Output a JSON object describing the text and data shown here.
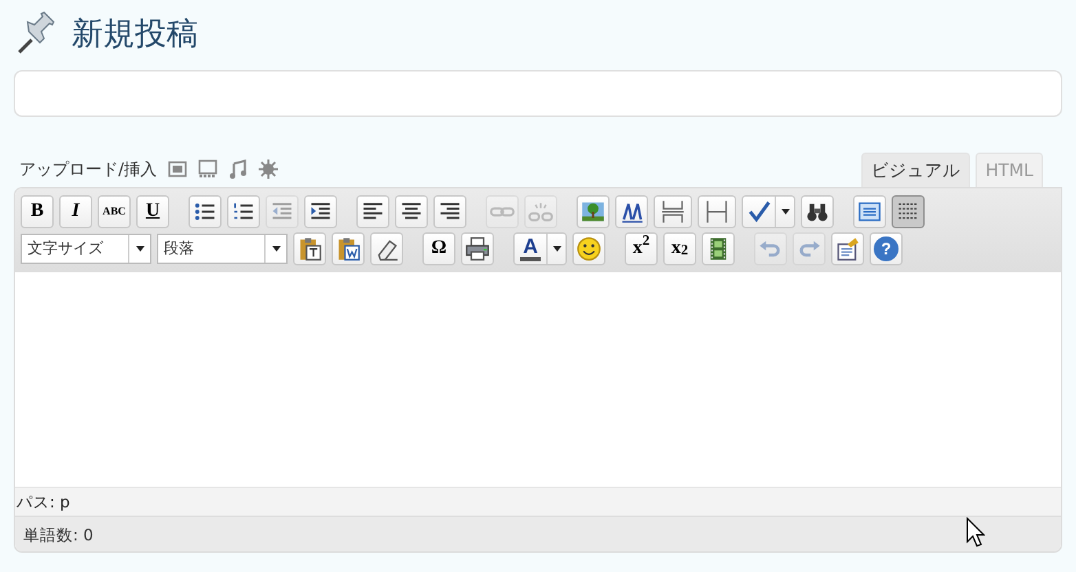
{
  "page_title": "新規投稿",
  "upload": {
    "label": "アップロード/挿入"
  },
  "tabs": [
    {
      "label": "ビジュアル",
      "selected": true
    },
    {
      "label": "HTML",
      "selected": false
    }
  ],
  "toolbar_rows": [
    [
      {
        "kind": "text",
        "label": "B",
        "disabled": false,
        "active": false
      },
      {
        "kind": "text",
        "label": "I",
        "disabled": false,
        "active": false
      },
      {
        "kind": "text",
        "label": "ABC",
        "disabled": false,
        "active": false
      },
      {
        "kind": "text",
        "label": "U",
        "disabled": false,
        "active": false
      },
      {
        "kind": "sep"
      },
      {
        "kind": "icon",
        "disabled": false,
        "active": false
      },
      {
        "kind": "icon",
        "disabled": false,
        "active": false
      },
      {
        "kind": "icon",
        "disabled": true,
        "active": false
      },
      {
        "kind": "icon",
        "disabled": false,
        "active": false
      },
      {
        "kind": "sep"
      },
      {
        "kind": "icon",
        "disabled": false,
        "active": false
      },
      {
        "kind": "icon",
        "disabled": false,
        "active": false
      },
      {
        "kind": "icon",
        "disabled": false,
        "active": false
      },
      {
        "kind": "sep"
      },
      {
        "kind": "icon",
        "disabled": true,
        "active": false
      },
      {
        "kind": "icon",
        "disabled": true,
        "active": false
      },
      {
        "kind": "sep"
      },
      {
        "kind": "icon",
        "disabled": false,
        "active": false
      },
      {
        "kind": "icon",
        "disabled": false,
        "active": false
      },
      {
        "kind": "icon",
        "disabled": false,
        "active": false
      },
      {
        "kind": "icon",
        "disabled": false,
        "active": false
      },
      {
        "kind": "split",
        "disabled": false,
        "active": false
      },
      {
        "kind": "icon",
        "disabled": false,
        "active": false
      },
      {
        "kind": "sep"
      },
      {
        "kind": "icon",
        "disabled": false,
        "active": false
      },
      {
        "kind": "icon",
        "disabled": false,
        "active": true
      }
    ],
    [
      {
        "kind": "select",
        "label": "文字サイズ"
      },
      {
        "kind": "select",
        "label": "段落"
      },
      {
        "kind": "icon",
        "disabled": false,
        "active": false
      },
      {
        "kind": "icon",
        "disabled": false,
        "active": false
      },
      {
        "kind": "icon",
        "disabled": false,
        "active": false
      },
      {
        "kind": "sep"
      },
      {
        "kind": "text",
        "label": "Ω",
        "disabled": false,
        "active": false
      },
      {
        "kind": "icon",
        "disabled": false,
        "active": false
      },
      {
        "kind": "sep"
      },
      {
        "kind": "colorsplit",
        "label": "A",
        "disabled": false,
        "active": false
      },
      {
        "kind": "icon",
        "disabled": false,
        "active": false
      },
      {
        "kind": "sep"
      },
      {
        "kind": "text",
        "label": "x$^{2}$",
        "disabled": false,
        "active": false
      },
      {
        "kind": "text",
        "label": "x$_{2}$",
        "disabled": false,
        "active": false
      },
      {
        "kind": "icon",
        "disabled": false,
        "active": false
      },
      {
        "kind": "sep"
      },
      {
        "kind": "icon",
        "disabled": true,
        "active": false
      },
      {
        "kind": "icon",
        "disabled": true,
        "active": false
      },
      {
        "kind": "icon",
        "disabled": false,
        "active": false
      },
      {
        "kind": "help",
        "label": "?",
        "disabled": false,
        "active": false
      }
    ]
  ],
  "path_bar": "パス: p",
  "word_count": "単語数: 0"
}
